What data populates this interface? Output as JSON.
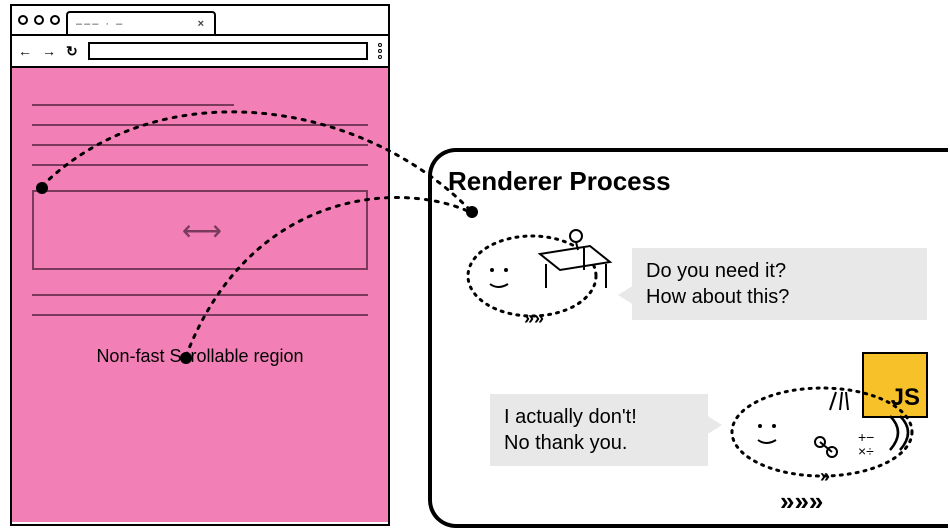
{
  "browser": {
    "tab_crumbs": "––– · –",
    "tab_close": "×"
  },
  "viewport": {
    "caption": "Non-fast Scrollable region"
  },
  "renderer": {
    "title": "Renderer Process",
    "bubble1_line1": "Do you need it?",
    "bubble1_line2": "How about this?",
    "bubble2_line1": "I actually don't!",
    "bubble2_line2": "No thank you."
  },
  "js_badge": "JS"
}
